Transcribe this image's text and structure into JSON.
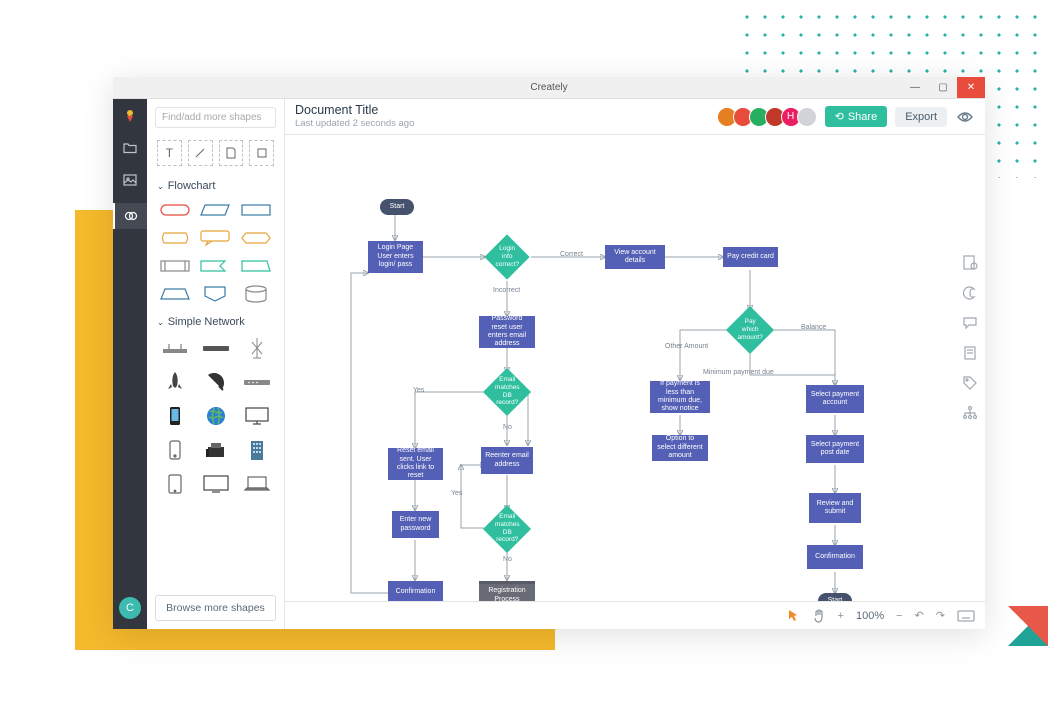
{
  "app": {
    "title": "Creately"
  },
  "window_controls": {
    "min": "—",
    "max": "▢",
    "close": "✕"
  },
  "rail": {
    "avatar": "C"
  },
  "shapes": {
    "search_placeholder": "Find/add more shapes",
    "tool_text": "T",
    "section_flowchart": "Flowchart",
    "section_network": "Simple Network",
    "browse": "Browse more shapes"
  },
  "header": {
    "title": "Document Title",
    "subtitle": "Last updated 2 seconds ago",
    "share": "Share",
    "export": "Export",
    "avatars": [
      "#e67e22",
      "#e74c3c",
      "#27ae60",
      "#c0392b",
      "#e91e63",
      "#bdc3c7"
    ],
    "avatar_h": "H"
  },
  "bottombar": {
    "zoom": "100%"
  },
  "flow": {
    "start": "Start",
    "login_page": "Login Page User enters login/ pass",
    "login_correct": "Login info correct?",
    "correct": "Correct",
    "incorrect": "Incorrect",
    "view_account": "View account details",
    "pay_card": "Pay credit card",
    "pwd_reset": "Password reset user enters email address",
    "email_matches": "Email matches DB record?",
    "yes": "Yes",
    "no": "No",
    "reset_sent": "Reset email sent. User clicks link to reset",
    "enter_pwd": "Enter new password",
    "reenter_email": "Reenter email address",
    "email_matches2": "Email matches DB record?",
    "registration": "Registration Process",
    "confirmation": "Confirmation",
    "pay_which": "Pay which amount?",
    "other_amount": "Other Amount",
    "min_due": "Minimum payment due",
    "balance": "Balance",
    "if_less": "If payment is less than minimum due, show notice",
    "option_select": "Option to select different amount",
    "select_acct": "Select payment account",
    "select_date": "Select payment post date",
    "review": "Review and submit",
    "confirmation2": "Confirmation",
    "end": "Start"
  }
}
